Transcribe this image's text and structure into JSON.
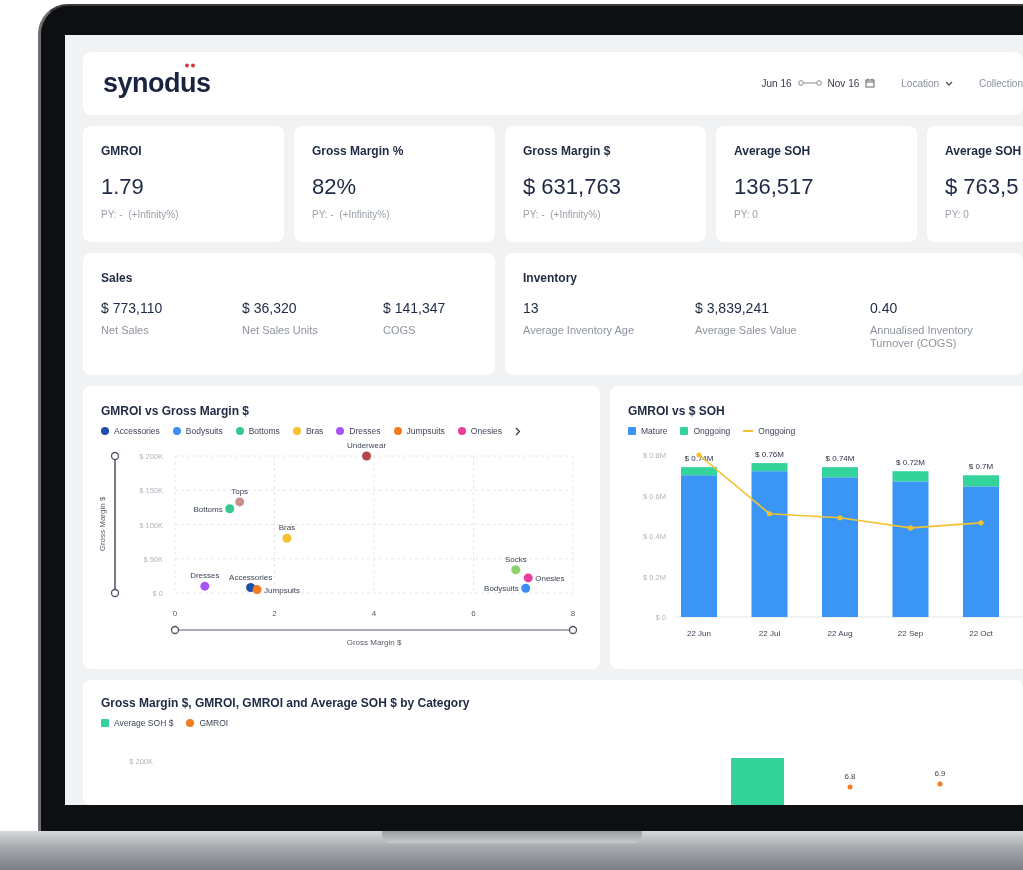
{
  "header": {
    "logo": "synodus",
    "date_from": "Jun 16",
    "date_to": "Nov 16",
    "filters": [
      {
        "label": "Location",
        "caret": true
      },
      {
        "label": "Collection",
        "caret": false
      }
    ]
  },
  "kpis": [
    {
      "title": "GMROI",
      "value": "1.79",
      "comparison": "PY: -  (+Infinity%)"
    },
    {
      "title": "Gross Margin %",
      "value": "82%",
      "comparison": "PY: -  (+Infinity%)"
    },
    {
      "title": "Gross Margin $",
      "value": "$ 631,763",
      "comparison": "PY: -  (+Infinity%)"
    },
    {
      "title": "Average SOH",
      "value": "136,517",
      "comparison": "PY: 0"
    },
    {
      "title": "Average SOH",
      "value": "$ 763,5",
      "comparison": "PY: 0"
    }
  ],
  "sales": {
    "title": "Sales",
    "metrics": [
      {
        "value": "$ 773,110",
        "label": "Net Sales"
      },
      {
        "value": "$ 36,320",
        "label": "Net Sales Units"
      },
      {
        "value": "$ 141,347",
        "label": "COGS"
      }
    ]
  },
  "inventory": {
    "title": "Inventory",
    "metrics": [
      {
        "value": "13",
        "label": "Average Inventory Age"
      },
      {
        "value": "$ 3,839,241",
        "label": "Average Sales Value"
      },
      {
        "value": "0.40",
        "label": "Annualised Inventory Turnover (COGS)"
      }
    ]
  },
  "scatter_card": {
    "title": "GMROI vs Gross Margin $",
    "legend": [
      {
        "label": "Accessories",
        "color": "#1e4fa8"
      },
      {
        "label": "Bodysuits",
        "color": "#3b8ff0"
      },
      {
        "label": "Bottoms",
        "color": "#34c98e"
      },
      {
        "label": "Bras",
        "color": "#f2c230"
      },
      {
        "label": "Dresses",
        "color": "#a855f7"
      },
      {
        "label": "Jumpsuits",
        "color": "#f47b20"
      },
      {
        "label": "Onesies",
        "color": "#e83e9c"
      }
    ],
    "chart_data": {
      "type": "scatter",
      "grid": true,
      "xlabel": "Gross Margin $",
      "ylabel": "Gross Margin $",
      "xlim": [
        0,
        8
      ],
      "ylim": [
        0,
        200000
      ],
      "xticks": [
        0,
        2,
        4,
        6,
        8
      ],
      "yticks": [
        {
          "value": 0,
          "label": "$ 0"
        },
        {
          "value": 50000,
          "label": "$ 50K"
        },
        {
          "value": 100000,
          "label": "$ 100K"
        },
        {
          "value": 150000,
          "label": "$ 150K"
        },
        {
          "value": 200000,
          "label": "$ 200K"
        }
      ],
      "series": [
        {
          "name": "Underwear",
          "color": "#b5454a",
          "x": [
            3.85
          ],
          "values": [
            200000
          ]
        },
        {
          "name": "Tops",
          "color": "#c9918a",
          "x": [
            1.3
          ],
          "values": [
            133000
          ]
        },
        {
          "name": "Bottoms",
          "color": "#34c98e",
          "x": [
            1.1
          ],
          "values": [
            123000
          ]
        },
        {
          "name": "Bras",
          "color": "#f2c230",
          "x": [
            2.25
          ],
          "values": [
            80000
          ]
        },
        {
          "name": "Dresses",
          "color": "#a855f7",
          "x": [
            0.6
          ],
          "values": [
            10000
          ]
        },
        {
          "name": "Accessories",
          "color": "#1e4fa8",
          "x": [
            1.52
          ],
          "values": [
            8000
          ]
        },
        {
          "name": "Jumpsuits",
          "color": "#f47b20",
          "x": [
            1.65
          ],
          "values": [
            5000
          ]
        },
        {
          "name": "Socks",
          "color": "#8ed36a",
          "x": [
            6.85
          ],
          "values": [
            34000
          ]
        },
        {
          "name": "Onesies",
          "color": "#e83e9c",
          "x": [
            7.1
          ],
          "values": [
            22000
          ]
        },
        {
          "name": "Bodysuits",
          "color": "#3b8ff0",
          "x": [
            7.05
          ],
          "values": [
            7000
          ]
        }
      ]
    }
  },
  "bar_card": {
    "title": "GMROI vs $ SOH",
    "chart_data": {
      "type": "bar",
      "stacked": true,
      "categories": [
        "22 Jun",
        "22 Jul",
        "22 Aug",
        "22 Sep",
        "22 Oct"
      ],
      "ylim": [
        0,
        0.8
      ],
      "yticks": [
        {
          "value": 0,
          "label": "$ 0"
        },
        {
          "value": 0.2,
          "label": "$ 0.2M"
        },
        {
          "value": 0.4,
          "label": "$ 0.4M"
        },
        {
          "value": 0.6,
          "label": "$ 0.6M"
        },
        {
          "value": 0.8,
          "label": "$ 0.8M"
        }
      ],
      "series": [
        {
          "name": "Mature",
          "color": "#3b95f5",
          "type": "bar",
          "values": [
            0.7,
            0.72,
            0.69,
            0.67,
            0.645
          ]
        },
        {
          "name": "Onggoing",
          "color": "#34d399",
          "type": "bar",
          "values": [
            0.04,
            0.04,
            0.05,
            0.05,
            0.055
          ]
        },
        {
          "name": "Onggoing",
          "color": "#f2c230",
          "type": "line",
          "values": [
            0.8,
            0.51,
            0.49,
            0.44,
            0.465
          ]
        }
      ],
      "value_labels": [
        "$ 0.74M",
        "$ 0.76M",
        "$ 0.74M",
        "$ 0.72M",
        "$ 0.7M"
      ]
    }
  },
  "category_card": {
    "title": "Gross Margin $, GMROI, GMROI and Average SOH $ by Category",
    "legend": [
      {
        "label": "Average SOH $",
        "color": "#34d399",
        "kind": "square"
      },
      {
        "label": "GMROI",
        "color": "#f47b20",
        "kind": "dot"
      }
    ],
    "tick_label": "$ 200K",
    "point_labels": [
      "6.8",
      "6.9"
    ]
  }
}
